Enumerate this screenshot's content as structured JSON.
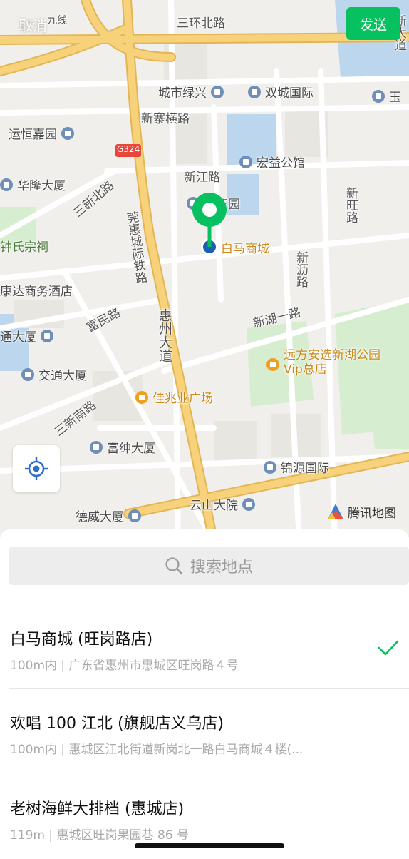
{
  "header": {
    "cancel_label": "取消",
    "send_label": "发送"
  },
  "map": {
    "labels": {
      "sanhuan_north": "三环北路",
      "jiu_xian": "九线",
      "xin_da_dao": "新大道",
      "chengshi_lvxing": "城市绿兴",
      "shuangcheng": "双城国际",
      "yu": "玉",
      "xinzhai": "新寨横路",
      "yunheng": "运恒嘉园",
      "g324": "G324",
      "hongyi": "宏益公馆",
      "hualong": "华隆大厦",
      "xinjiang": "新江路",
      "sanxinbei": "三新北路",
      "tai_huayuan": "台花园",
      "xinwang": "新旺路",
      "guanhui": "莞惠城际铁路",
      "baima": "白马商城",
      "zhongshi": "钟氏宗祠",
      "xinli": "新沥路",
      "kangda": "康达商务酒店",
      "fumin": "富民路",
      "xinhu": "新湖一路",
      "huizhou_dadao": "惠州大道",
      "tong_dasha": "通大厦",
      "yuanfang": "远方安选新湖公园Vip总店",
      "jiaotong": "交通大厦",
      "sanxinnan": "三新南路",
      "jiazhao": "佳兆业广场",
      "fushen": "富绅大厦",
      "jinyuan": "锦源国际",
      "yunshan": "云山大院",
      "dewei": "德威大厦"
    },
    "brand": "腾讯地图",
    "colors": {
      "land": "#f1efeb",
      "road_major": "#f7d27a",
      "road_major_edge": "#e2b555",
      "water": "#bcd6ee",
      "park": "#d6edcf",
      "pin": "#07c160",
      "pin_dot": "#1a5fb4"
    }
  },
  "search": {
    "placeholder": "搜索地点"
  },
  "results": [
    {
      "name": "白马商城 (旺岗路店)",
      "address": "100m内 | 广东省惠州市惠城区旺岗路４号",
      "selected": true
    },
    {
      "name": "欢唱 100 江北 (旗舰店义乌店)",
      "address": "100m内 | 惠城区江北街道新岗北一路白马商城４楼(...",
      "selected": false
    },
    {
      "name": "老树海鲜大排档 (惠城店)",
      "address": "119m | 惠城区旺岗果园巷 86 号",
      "selected": false
    }
  ],
  "accent_color": "#07c160"
}
